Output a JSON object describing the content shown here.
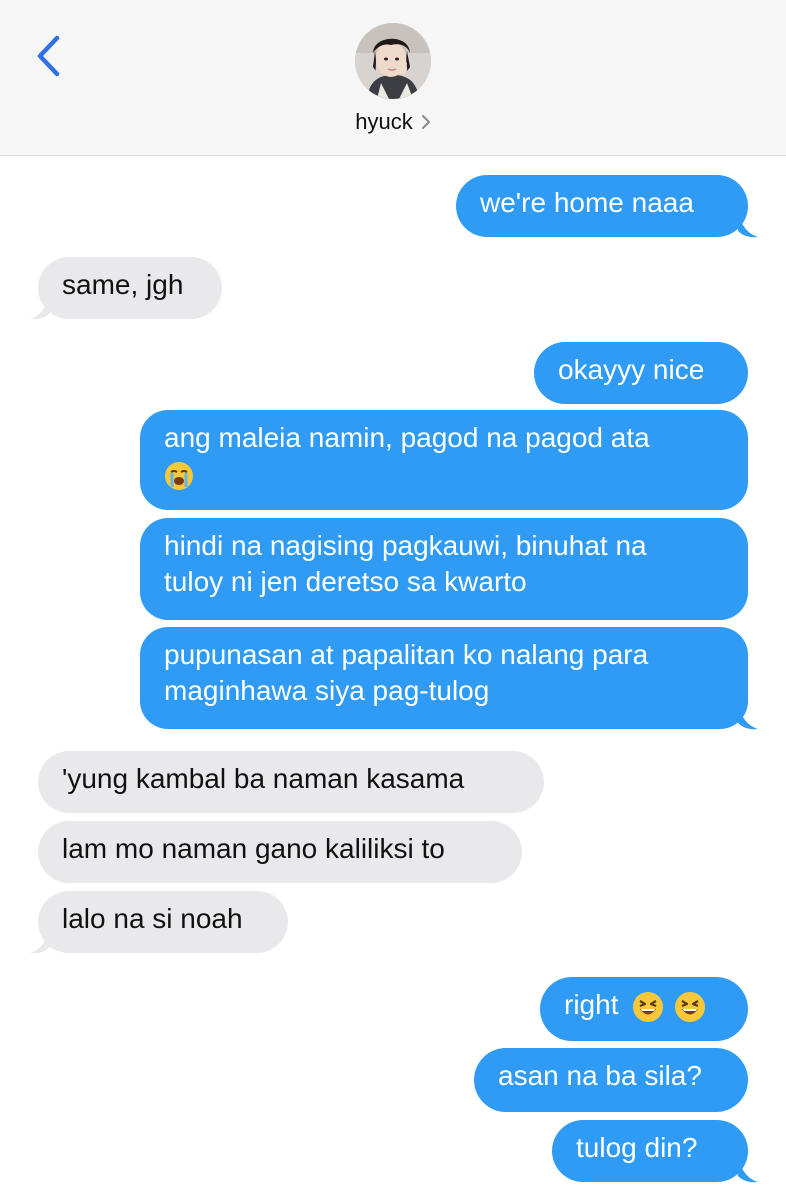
{
  "header": {
    "back_icon": "chevron-left-icon",
    "contact_name": "hyuck",
    "disclosure_icon": "chevron-right-icon",
    "accent_color": "#2f6fe8"
  },
  "colors": {
    "outgoing": "#2f9bf4",
    "incoming": "#e9e9eb"
  },
  "messages": [
    {
      "side": "out",
      "text": "we're home naaa"
    },
    {
      "side": "in",
      "text": "same, jgh"
    },
    {
      "side": "out",
      "text": "okayyy nice"
    },
    {
      "side": "out",
      "lines": [
        "ang maleia namin, pagod na pagod ata",
        ""
      ],
      "emoji": "loudly-crying-face-emoji"
    },
    {
      "side": "out",
      "lines": [
        "hindi na nagising pagkauwi, binuhat na",
        "tuloy ni jen deretso sa kwarto"
      ]
    },
    {
      "side": "out",
      "lines": [
        "pupunasan at papalitan ko nalang para",
        "maginhawa siya pag-tulog"
      ]
    },
    {
      "side": "in",
      "text": "'yung kambal ba naman kasama"
    },
    {
      "side": "in",
      "text": "lam mo naman gano kaliliksi to"
    },
    {
      "side": "in",
      "text": "lalo na si noah"
    },
    {
      "side": "out",
      "text": "right",
      "emoji": "grinning-squinting-face-emoji"
    },
    {
      "side": "out",
      "text": "asan na ba sila?"
    },
    {
      "side": "out",
      "text": "tulog din?"
    }
  ]
}
